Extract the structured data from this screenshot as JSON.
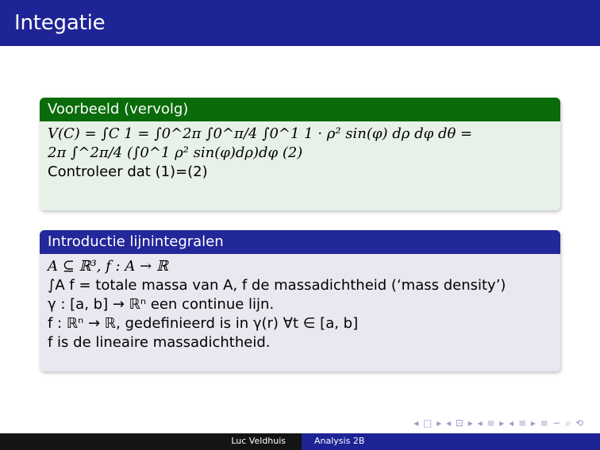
{
  "slide": {
    "title": "Integatie"
  },
  "example_block": {
    "title": "Voorbeeld (vervolg)",
    "lines": [
      "V(C) = ∫C 1 = ∫0^2π ∫0^π/4 ∫0^1 1 · ρ² sin(φ) dρ dφ dθ =",
      "2π ∫^2π/4 (∫0^1 ρ² sin(φ)dρ)dφ (2)",
      "Controleer dat (1)=(2)"
    ]
  },
  "intro_block": {
    "title": "Introductie lijnintegralen",
    "lines": [
      "A ⊆ ℝ³, f : A → ℝ",
      "∫A f = totale massa van A, f de massadichtheid (‘mass density’)",
      "γ : [a, b] → ℝⁿ een continue lijn.",
      "f : ℝⁿ → ℝ, gedefinieerd is in γ(r) ∀t ∈ [a, b]",
      "f is de lineaire massadichtheid."
    ]
  },
  "footer": {
    "author": "Luc Veldhuis",
    "course": "Analysis 2B"
  },
  "nav": {
    "symbols": "◂ □ ▸ ◂ ⊡ ▸ ◂ ≡ ▸ ◂ ≡ ▸ ≡ ∽ ⌕ ⟲"
  }
}
